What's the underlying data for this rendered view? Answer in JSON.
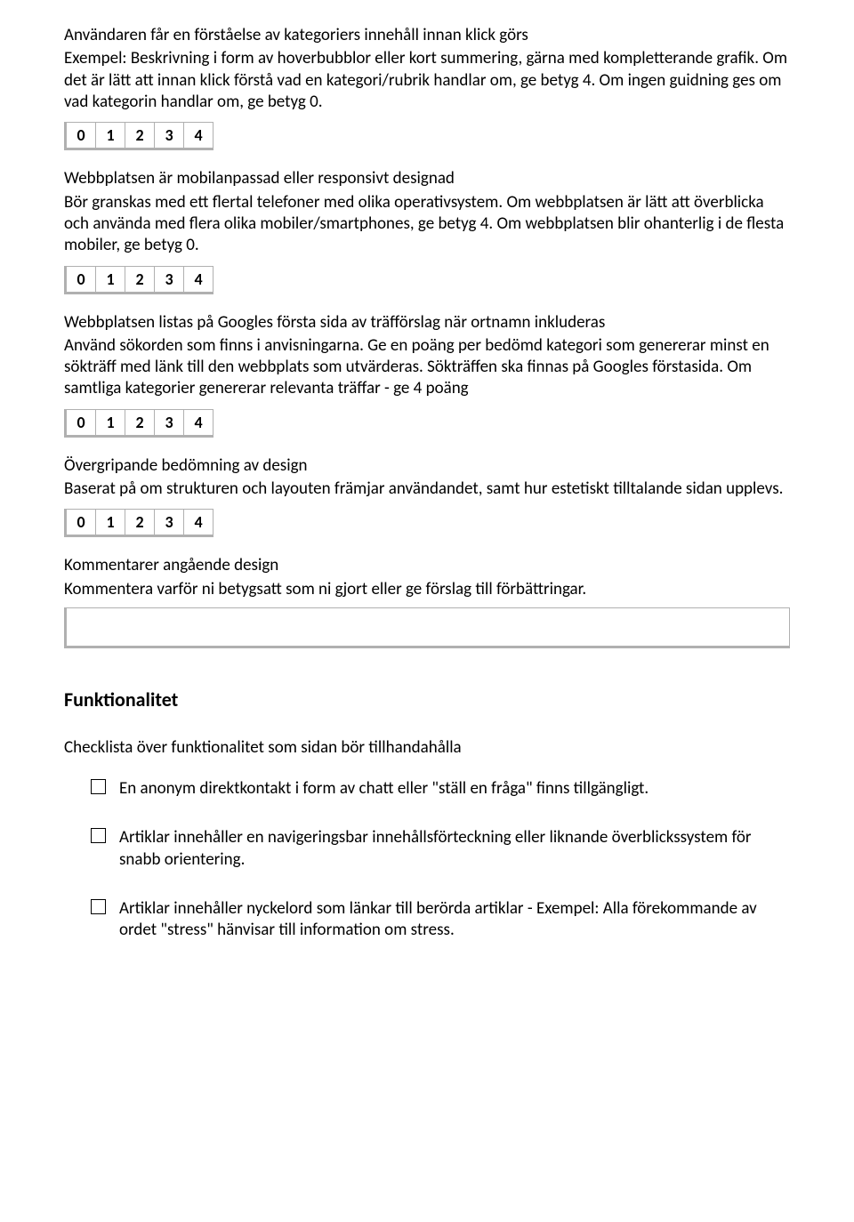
{
  "ratings": [
    "0",
    "1",
    "2",
    "3",
    "4"
  ],
  "sections": [
    {
      "title": "Användaren får en förståelse av kategoriers innehåll innan klick görs",
      "desc": "Exempel: Beskrivning i form av hoverbubblor eller kort summering, gärna med kompletterande grafik. Om det är lätt att innan klick förstå vad en kategori/rubrik handlar om, ge betyg 4. Om ingen guidning ges om vad kategorin handlar om, ge betyg 0."
    },
    {
      "title": "Webbplatsen är mobilanpassad eller responsivt designad",
      "desc": "Bör granskas med ett flertal telefoner med olika operativsystem. Om webbplatsen är lätt att överblicka och använda med flera olika mobiler/smartphones, ge betyg 4. Om webbplatsen blir ohanterlig i de flesta mobiler, ge betyg 0."
    },
    {
      "title": "Webbplatsen listas på Googles första sida av träfförslag när ortnamn inkluderas",
      "desc": "Använd sökorden som finns i anvisningarna. Ge en poäng per bedömd kategori som genererar minst en sökträff med länk till den webbplats som utvärderas. Sökträffen ska finnas på Googles förstasida. Om samtliga kategorier genererar relevanta träffar - ge 4 poäng"
    },
    {
      "title": "Övergripande bedömning av design",
      "desc": "Baserat på om strukturen och layouten främjar användandet, samt hur estetiskt tilltalande sidan upplevs."
    }
  ],
  "comments": {
    "title": "Kommentarer angående design",
    "desc": "Kommentera varför ni betygsatt som ni gjort eller ge förslag till förbättringar."
  },
  "funk": {
    "heading": "Funktionalitet",
    "sub": "Checklista över funktionalitet som sidan bör tillhandahålla",
    "items": [
      "En anonym direktkontakt i form av chatt eller \"ställ en fråga\" finns tillgängligt.",
      "Artiklar innehåller en navigeringsbar innehållsförteckning eller liknande överblickssystem för snabb orientering.",
      "Artiklar innehåller nyckelord som länkar till berörda artiklar - Exempel: Alla förekommande av ordet \"stress\" hänvisar till information om stress."
    ]
  }
}
